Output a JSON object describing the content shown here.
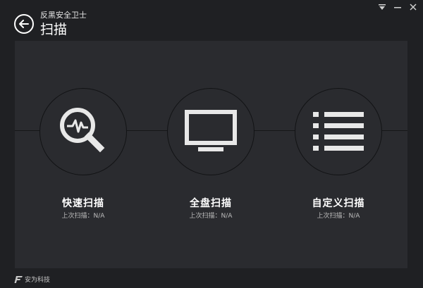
{
  "window": {
    "app_name": "反黑安全卫士",
    "page_title": "扫描",
    "controls": [
      {
        "icon": "menu-dropdown-icon"
      },
      {
        "icon": "minimize-icon"
      },
      {
        "icon": "close-icon"
      }
    ]
  },
  "scans": [
    {
      "icon": "pulse-magnifier-icon",
      "title": "快速扫描",
      "last_scan_label": "上次扫描：",
      "last_scan_value": "N/A"
    },
    {
      "icon": "monitor-icon",
      "title": "全盘扫描",
      "last_scan_label": "上次扫描：",
      "last_scan_value": "N/A"
    },
    {
      "icon": "list-icon",
      "title": "自定义扫描",
      "last_scan_label": "上次扫描：",
      "last_scan_value": "N/A"
    }
  ],
  "footer": {
    "brand": "安为科技",
    "icon": "anwei-logo-icon"
  },
  "colors": {
    "background": "#1f2023",
    "panel": "#2a2b2f",
    "icon": "#e8e8e8",
    "text": "#ffffff",
    "subtext": "#bdbdbd"
  }
}
